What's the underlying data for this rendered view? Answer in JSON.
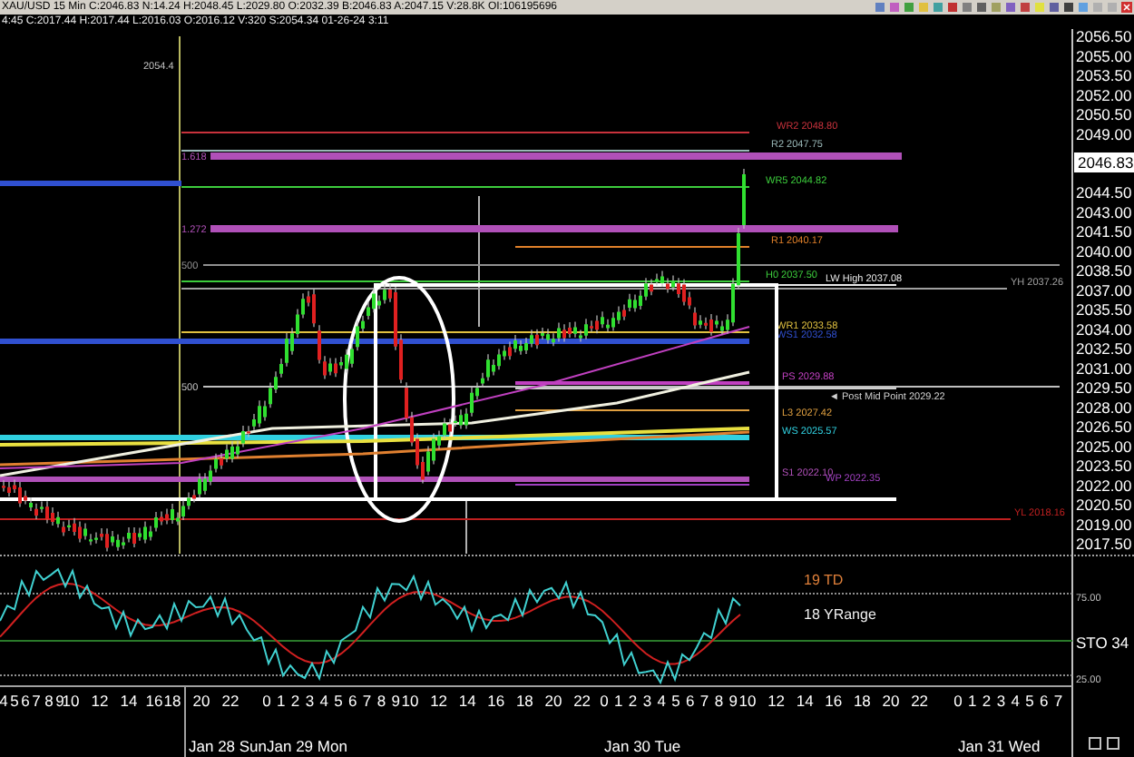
{
  "window": {
    "title": "XAU/USD 15 Min C:2046.83 N:14.24 H:2048.45 L:2029.80 O:2032.39 B:2046.83 A:2047.15 V:28.8K OI:106195696"
  },
  "info_line": "4:45 C:2017.44 H:2017.44 L:2016.03 O:2016.12 V:320 S:2054.34 01-26-24 3:11",
  "price_chart": {
    "note": "2054.4",
    "levels": [
      {
        "label": "WR2 2048.80",
        "color": "#c8323c"
      },
      {
        "label": "R2 2047.75",
        "color": "#9ab8b8"
      },
      {
        "label": "1.618",
        "color": "#b050b8"
      },
      {
        "label": "WR5 2044.82",
        "color": "#3ccc3c"
      },
      {
        "label": "1.272",
        "color": "#b050b8"
      },
      {
        "label": "R1 2040.17",
        "color": "#e0802a"
      },
      {
        "label": "500",
        "color": "#909090"
      },
      {
        "label": "H0 2037.50",
        "color": "#3ccc3c"
      },
      {
        "label": "LW High 2037.08",
        "color": "#e8e8e8"
      },
      {
        "label": "YH 2037.26",
        "color": "#a0a0a0"
      },
      {
        "label": "WR1 2033.58",
        "color": "#e0c040"
      },
      {
        "label": "WS1 2032.58",
        "color": "#3050d0"
      },
      {
        "label": "PS 2029.88",
        "color": "#c040c0"
      },
      {
        "label": "500",
        "color": "#c0c0c0"
      },
      {
        "label": "◄ Post Mid Point 2029.22",
        "color": "#d0d0d0"
      },
      {
        "label": "L3 2027.42",
        "color": "#e0a040"
      },
      {
        "label": "WS 2025.57",
        "color": "#30d0e0"
      },
      {
        "label": "S1 2022.10",
        "color": "#b050b8"
      },
      {
        "label": "WP 2022.35",
        "color": "#a040c0"
      },
      {
        "color": "#ffffff"
      },
      {
        "label": "YL 2018.16",
        "color": "#c02020"
      }
    ],
    "price_axis": [
      "2056.50",
      "2055.00",
      "2053.50",
      "2052.00",
      "2050.50",
      "2049.00",
      "2044.50",
      "2043.00",
      "2041.50",
      "2040.00",
      "2038.50",
      "2037.00",
      "2035.50",
      "2034.00",
      "2032.50",
      "2031.00",
      "2029.50",
      "2028.00",
      "2026.50",
      "2025.00",
      "2023.50",
      "2022.00",
      "2020.50",
      "2019.00",
      "2017.50"
    ],
    "last_price": "2046.83"
  },
  "oscillator": {
    "name": "STO 34",
    "legend": [
      {
        "label": "19 TD",
        "color": "#e0803a"
      },
      {
        "label": "18 YRange",
        "color": "#f0f0f0"
      }
    ],
    "axis": [
      "75.00",
      "25.00"
    ]
  },
  "time_axis": {
    "hours": [
      "4",
      "5",
      "6",
      "7",
      "8",
      "9",
      "10",
      "12",
      "14",
      "16",
      "18",
      "20",
      "22",
      "0",
      "1",
      "2",
      "3",
      "4",
      "5",
      "6",
      "7",
      "8",
      "9",
      "10",
      "12",
      "14",
      "16",
      "18",
      "20",
      "22",
      "0",
      "1",
      "2",
      "3",
      "4",
      "5",
      "6",
      "7",
      "8",
      "9",
      "10",
      "12",
      "14",
      "16",
      "18",
      "20",
      "22",
      "0",
      "1",
      "2",
      "3",
      "4",
      "5",
      "6",
      "7"
    ],
    "dates": [
      "Jan 28 Sun",
      "Jan 29 Mon",
      "Jan 30 Tue",
      "Jan 31 Wed"
    ]
  }
}
